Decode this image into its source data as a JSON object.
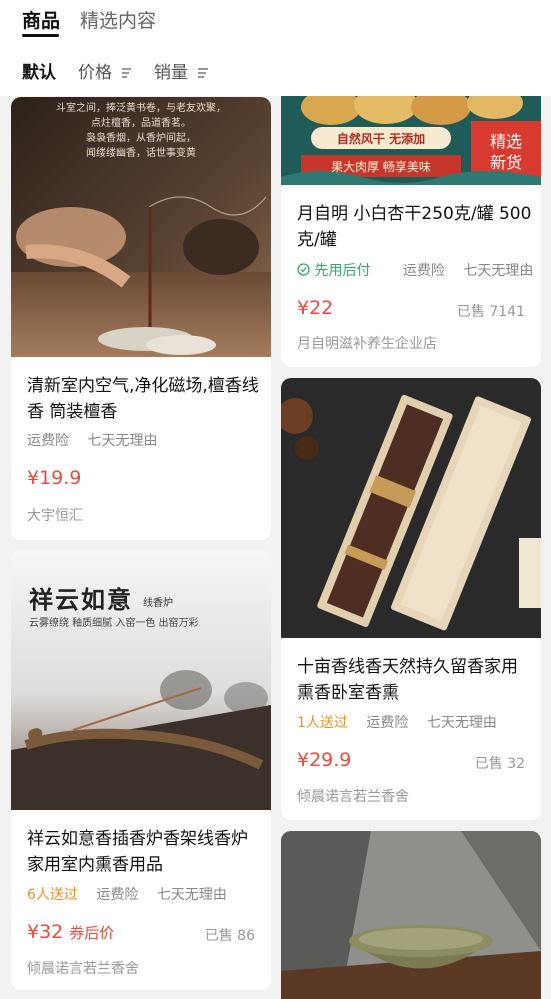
{
  "tabs": [
    {
      "label": "商品",
      "active": true
    },
    {
      "label": "精选内容",
      "active": false
    }
  ],
  "sorts": [
    {
      "label": "默认",
      "active": true
    },
    {
      "label": "价格",
      "icon": "sort-icon"
    },
    {
      "label": "销量",
      "icon": "sort-icon"
    }
  ],
  "products": {
    "incense": {
      "img_caption": [
        "斗室之间，捧泛黄书卷，与老友欢聚，",
        "点炷檀香，品道香茗。",
        "袅袅香烟，从香炉间起，",
        "闻缕缕幽香，话世事变黄"
      ],
      "title": "清新室内空气,净化磁场,檀香线香 筒装檀香",
      "tags": [
        "运费险",
        "七天无理由"
      ],
      "price": "¥19.9",
      "shop": "大宇恒汇"
    },
    "apricot": {
      "img_badge_top": "自然风干 无添加",
      "img_badge_bottom": "果大肉厚 畅享美味",
      "img_corner": [
        "精选",
        "新货"
      ],
      "title": "月自明 小白杏干250克/罐 500克/罐",
      "tags_green": "先用后付",
      "tags": [
        "运费险",
        "七天无理由"
      ],
      "price": "¥22",
      "sold": "已售 7141",
      "shop": "月自明滋补养生企业店"
    },
    "xiangyun": {
      "img_title": "祥云如意",
      "img_subtitle": "线香炉",
      "img_slogan": "云雾缭绕 釉质细腻 入窑一色 出窑万彩",
      "title": "祥云如意香插香炉香架线香炉家用室内熏香用品",
      "tags_orange": "6人送过",
      "tags": [
        "运费险",
        "七天无理由"
      ],
      "price": "¥32",
      "coupon": "券后价",
      "sold": "已售 86",
      "shop": "倾晨诺言若兰香舍"
    },
    "shimu": {
      "title": "十亩香线香天然持久留香家用熏香卧室香熏",
      "tags_orange": "1人送过",
      "tags": [
        "运费险",
        "七天无理由"
      ],
      "price": "¥29.9",
      "sold": "已售 32",
      "shop": "倾晨诺言若兰香舍"
    }
  }
}
